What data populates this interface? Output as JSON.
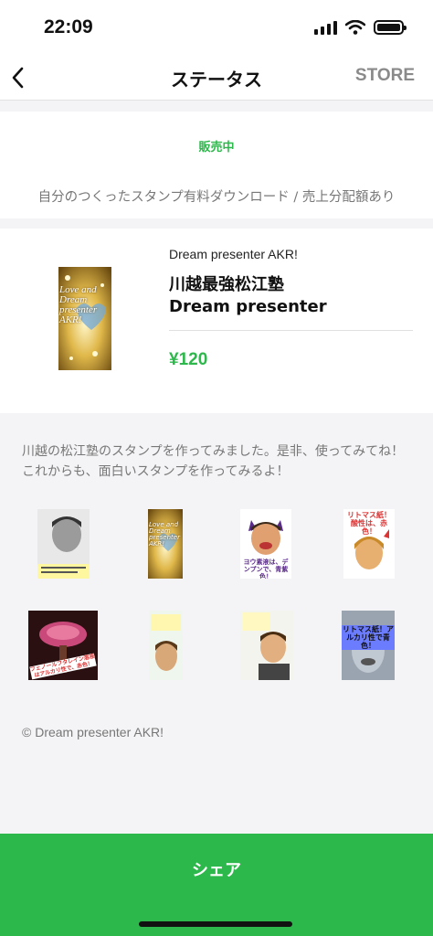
{
  "statusbar": {
    "time": "22:09"
  },
  "navbar": {
    "title": "ステータス",
    "store_label": "STORE"
  },
  "status": {
    "state": "販売中",
    "description": "自分のつくったスタンプ有料ダウンロード / 売上分配額あり"
  },
  "product": {
    "author": "Dream presenter AKR!",
    "name": "川越最強松江塾　　　Dream presenter",
    "price": "¥120",
    "thumb_text": "Love and Dream presenter AKR!"
  },
  "description": "川越の松江塾のスタンプを作ってみました。是非、使ってみてね！これからも、面白いスタンプを作ってみるよ！",
  "stickers": [
    {
      "caption": ""
    },
    {
      "caption": "Love and Dream presenter AKR!"
    },
    {
      "caption": "ヨウ素液は、デンプンで、青紫色！"
    },
    {
      "caption": "リトマス紙！酸性は、赤色！"
    },
    {
      "caption": "フェノールフタレイン溶液はアルカリ性で、赤色！"
    },
    {
      "caption": ""
    },
    {
      "caption": ""
    },
    {
      "caption": "リトマス紙！アルカリ性で青色！"
    }
  ],
  "copyright": "© Dream presenter AKR!",
  "share_label": "シェア",
  "colors": {
    "accent": "#2db84b",
    "muted_text": "#777777"
  }
}
